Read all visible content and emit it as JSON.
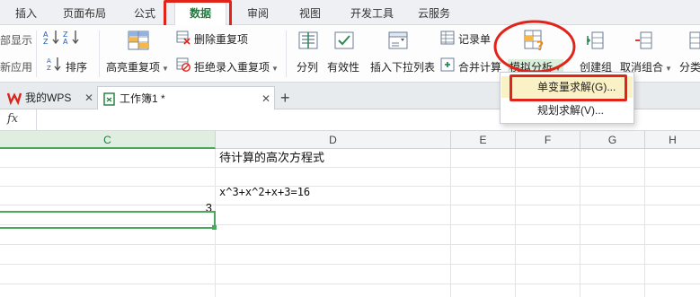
{
  "menu": {
    "tabs": [
      "插入",
      "页面布局",
      "公式",
      "数据",
      "审阅",
      "视图",
      "开发工具",
      "云服务"
    ],
    "active_tab": "数据"
  },
  "ribbon": {
    "left_partial": [
      "部显示",
      "新应用"
    ],
    "sort_label": "排序",
    "highlight_dup_label": "高亮重复项",
    "delete_dup_label": "删除重复项",
    "reject_dup_label": "拒绝录入重复项",
    "split_label": "分列",
    "validity_label": "有效性",
    "insert_dropdown_label": "插入下拉列表",
    "record_label": "记录单",
    "merge_calc_label": "合并计算",
    "whatif_label": "模拟分析",
    "create_group_label": "创建组",
    "ungroup_label": "取消组合",
    "subtotal_label": "分类"
  },
  "dropdown": {
    "items": [
      "单变量求解(G)...",
      "规划求解(V)..."
    ]
  },
  "doc_tabs": {
    "wps_label": "我的WPS",
    "workbook_label": "工作簿1 *",
    "add_symbol": "+"
  },
  "formula_bar": {
    "fx_label": "fx"
  },
  "sheet": {
    "columns": [
      "C",
      "D",
      "E",
      "F",
      "G",
      "H"
    ],
    "selected_column": "C",
    "cells": {
      "D1": "待计算的高次方程式",
      "D3": "x^3+x^2+x+3=16",
      "C4": "3"
    }
  },
  "colors": {
    "accent_green": "#1e7c3c",
    "highlight_red": "#e2231a",
    "dropdown_highlight": "#fbf1c7"
  }
}
